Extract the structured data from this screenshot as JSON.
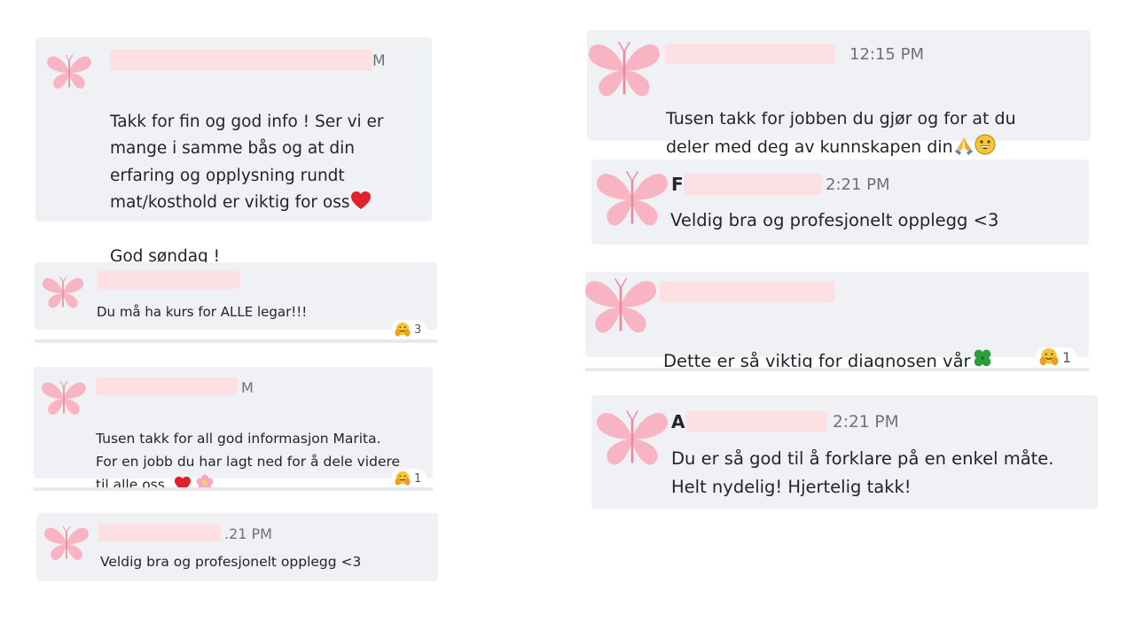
{
  "accent": {
    "card_bg": "#f0f1f5",
    "butterfly": "#f9b4c3",
    "redaction": "#fde0e3"
  },
  "comments": [
    {
      "author_visible": "",
      "time_visible": "M",
      "text": "Takk for fin og god info ! Ser vi er\nmange i samme bås og at din\nerfaring og opplysning rundt\nmat/kosthold er viktig for oss",
      "text_tail": "God søndag !",
      "emojis": [
        "heart"
      ]
    },
    {
      "author_visible": "",
      "time_visible": "",
      "text": "Du må ha kurs for ALLE legar!!!",
      "reaction": {
        "icon": "hug-emoji",
        "count": "3"
      }
    },
    {
      "author_visible": "",
      "time_visible": "M",
      "text": "Tusen takk for all god informasjon Marita.\nFor en jobb du har lagt ned for å dele videre\ntil alle oss.",
      "emojis": [
        "heart",
        "flower"
      ],
      "reaction": {
        "icon": "hug-emoji",
        "count": "1"
      }
    },
    {
      "author_visible": "",
      "time_visible": ".21 PM",
      "text": "Veldig bra og profesjonelt opplegg <3"
    },
    {
      "author_visible": "",
      "time_visible": "12:15 PM",
      "text": "Tusen takk for jobben du gjør og for at du\ndeler med deg av kunnskapen din",
      "emojis": [
        "pray",
        "grin"
      ]
    },
    {
      "author_visible": "F",
      "time_visible": "2:21 PM",
      "text": "Veldig bra og profesjonelt opplegg <3"
    },
    {
      "author_visible": "",
      "time_visible": "",
      "text": "Dette er så viktig for diagnosen vår",
      "emojis": [
        "clover"
      ],
      "reaction": {
        "icon": "hug-emoji",
        "count": "1"
      }
    },
    {
      "author_visible": "A",
      "time_visible": "2:21 PM",
      "text": "Du er så god til å forklare på en enkel måte.\nHelt nydelig! Hjertelig takk!"
    }
  ]
}
